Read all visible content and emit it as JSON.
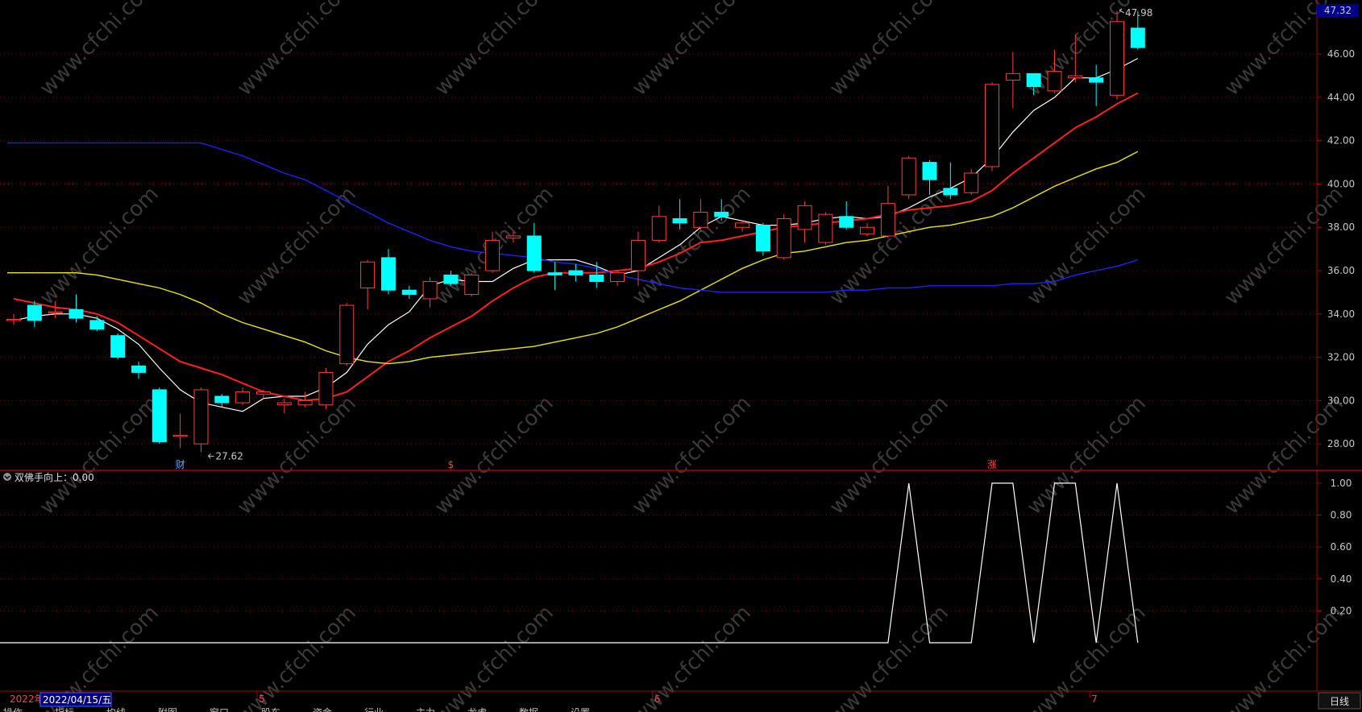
{
  "price_panel": {
    "current_price": "47.32",
    "high_label": "47.98",
    "low_label": "27.62",
    "event_markers": [
      {
        "text": "财",
        "color": "#5fa8ff",
        "idx": 8
      },
      {
        "text": "$",
        "color": "#ff4040",
        "idx": 21
      },
      {
        "text": "涨",
        "color": "#ff4040",
        "idx": 47
      }
    ]
  },
  "indicator_panel": {
    "label": "双佛手向上：0.00"
  },
  "time_axis": {
    "start_label": "2022年",
    "cursor_date": "2022/04/15/五",
    "month_labels": [
      {
        "text": "5",
        "idx": 12
      },
      {
        "text": "6",
        "idx": 31
      },
      {
        "text": "7",
        "idx": 52
      }
    ],
    "period_button": "日线"
  },
  "bottom_bar": {
    "items": [
      "操作",
      "指标",
      "均线",
      "附图",
      "窗口",
      "股东",
      "资金",
      "行业",
      "主力",
      "龙虎",
      "数据",
      "设置"
    ]
  },
  "colors": {
    "up": "#ff3c3c",
    "down": "#00ffff",
    "ma5": "#ffffff",
    "ma10": "#ff2020",
    "ma20": "#e8e800",
    "ma60": "#2020ff",
    "grid": "#8b0000",
    "panel_border": "#b00000",
    "indicator_line": "#ffffff"
  },
  "chart_data": [
    {
      "type": "candlestick",
      "title": "",
      "ylim": [
        27.0,
        48.2
      ],
      "ytick_labels": [
        "28.00",
        "30.00",
        "32.00",
        "34.00",
        "36.00",
        "38.00",
        "40.00",
        "42.00",
        "44.00",
        "46.00"
      ],
      "ohlc": [
        [
          33.75,
          33.75,
          33.5,
          34.0
        ],
        [
          34.4,
          33.7,
          33.4,
          34.6
        ],
        [
          34.1,
          34.1,
          33.8,
          34.6
        ],
        [
          34.2,
          33.8,
          33.6,
          34.9
        ],
        [
          33.7,
          33.3,
          33.2,
          33.9
        ],
        [
          33.0,
          32.0,
          31.9,
          33.1
        ],
        [
          31.6,
          31.3,
          31.0,
          31.8
        ],
        [
          30.5,
          28.1,
          28.0,
          30.6
        ],
        [
          28.4,
          28.4,
          27.8,
          29.4
        ],
        [
          28.0,
          30.5,
          27.62,
          30.6
        ],
        [
          30.2,
          29.9,
          29.7,
          30.3
        ],
        [
          29.9,
          30.4,
          29.8,
          30.6
        ],
        [
          30.3,
          30.4,
          30.1,
          30.5
        ],
        [
          29.8,
          29.9,
          29.4,
          30.1
        ],
        [
          29.8,
          30.0,
          29.7,
          30.4
        ],
        [
          29.8,
          31.3,
          29.6,
          31.5
        ],
        [
          31.7,
          34.4,
          31.6,
          34.5
        ],
        [
          35.2,
          36.4,
          34.2,
          36.5
        ],
        [
          36.6,
          35.1,
          34.9,
          37.0
        ],
        [
          35.1,
          34.9,
          34.7,
          35.3
        ],
        [
          34.7,
          35.5,
          34.3,
          35.7
        ],
        [
          35.8,
          35.4,
          35.3,
          36.0
        ],
        [
          34.9,
          35.8,
          34.8,
          35.9
        ],
        [
          36.0,
          37.4,
          35.9,
          37.8
        ],
        [
          37.5,
          37.6,
          37.3,
          37.8
        ],
        [
          37.6,
          36.0,
          35.9,
          38.2
        ],
        [
          35.9,
          35.8,
          35.1,
          36.4
        ],
        [
          36.0,
          35.8,
          35.5,
          36.3
        ],
        [
          35.8,
          35.5,
          35.2,
          36.4
        ],
        [
          35.5,
          35.9,
          35.3,
          36.0
        ],
        [
          36.0,
          37.4,
          35.3,
          37.8
        ],
        [
          37.4,
          38.5,
          37.3,
          39.0
        ],
        [
          38.4,
          38.2,
          37.9,
          39.3
        ],
        [
          38.0,
          38.7,
          37.8,
          39.3
        ],
        [
          38.7,
          38.5,
          38.3,
          39.3
        ],
        [
          38.0,
          38.2,
          37.8,
          38.3
        ],
        [
          38.1,
          36.9,
          36.7,
          38.2
        ],
        [
          36.6,
          38.4,
          36.5,
          38.6
        ],
        [
          37.9,
          39.0,
          37.3,
          39.2
        ],
        [
          37.3,
          38.6,
          37.2,
          38.7
        ],
        [
          38.5,
          38.0,
          37.9,
          39.2
        ],
        [
          37.7,
          38.0,
          37.6,
          38.2
        ],
        [
          37.6,
          39.1,
          37.5,
          39.9
        ],
        [
          39.5,
          41.2,
          39.3,
          41.3
        ],
        [
          41.0,
          40.2,
          39.5,
          41.1
        ],
        [
          39.8,
          39.5,
          39.3,
          41.0
        ],
        [
          39.6,
          40.5,
          39.5,
          40.7
        ],
        [
          40.8,
          44.6,
          40.6,
          44.7
        ],
        [
          44.8,
          45.1,
          43.5,
          46.1
        ],
        [
          45.1,
          44.5,
          44.1,
          45.1
        ],
        [
          44.3,
          45.2,
          44.2,
          46.2
        ],
        [
          44.9,
          45.0,
          44.7,
          46.9
        ],
        [
          44.9,
          44.7,
          43.6,
          45.5
        ],
        [
          44.1,
          47.5,
          43.9,
          47.98
        ],
        [
          47.2,
          46.3,
          46.2,
          47.98
        ]
      ],
      "series": [
        {
          "name": "MA5",
          "values": [
            33.7,
            33.9,
            34.0,
            34.0,
            33.8,
            33.3,
            32.6,
            31.5,
            30.5,
            29.9,
            29.7,
            29.5,
            30.1,
            30.2,
            30.2,
            30.6,
            31.3,
            32.6,
            33.5,
            34.1,
            35.3,
            35.6,
            35.5,
            35.5,
            36.1,
            36.5,
            36.5,
            36.5,
            36.2,
            35.8,
            36.0,
            36.6,
            37.2,
            38.0,
            38.5,
            38.3,
            38.1,
            38.1,
            38.2,
            38.4,
            38.5,
            38.4,
            38.5,
            38.9,
            39.4,
            39.8,
            40.3,
            41.2,
            42.4,
            43.4,
            44.0,
            44.9,
            44.9,
            45.3,
            45.8
          ]
        },
        {
          "name": "MA10",
          "values": [
            34.7,
            34.5,
            34.3,
            34.2,
            34.0,
            33.6,
            33.0,
            32.4,
            31.8,
            31.5,
            31.2,
            30.8,
            30.4,
            30.2,
            30.0,
            30.1,
            30.4,
            31.1,
            31.8,
            32.3,
            32.9,
            33.4,
            33.9,
            34.6,
            35.2,
            35.7,
            35.9,
            35.9,
            35.9,
            36.0,
            36.1,
            36.4,
            36.8,
            37.3,
            37.4,
            37.6,
            37.8,
            38.0,
            38.1,
            38.2,
            38.3,
            38.4,
            38.6,
            38.8,
            38.9,
            39.0,
            39.2,
            39.7,
            40.5,
            41.2,
            41.9,
            42.6,
            43.1,
            43.7,
            44.2
          ]
        },
        {
          "name": "MA20",
          "values": [
            35.9,
            35.8,
            35.6,
            35.4,
            35.2,
            34.9,
            34.5,
            34.0,
            33.6,
            33.3,
            33.0,
            32.7,
            32.3,
            32.0,
            31.8,
            31.7,
            31.8,
            32.0,
            32.1,
            32.2,
            32.3,
            32.4,
            32.5,
            32.7,
            32.9,
            33.1,
            33.4,
            33.8,
            34.2,
            34.6,
            35.1,
            35.6,
            36.1,
            36.5,
            36.8,
            36.9,
            37.1,
            37.3,
            37.4,
            37.6,
            37.8,
            38.0,
            38.1,
            38.3,
            38.5,
            38.9,
            39.4,
            39.9,
            40.3,
            40.7,
            41.0,
            41.5
          ]
        },
        {
          "name": "MA60",
          "values": [
            41.9,
            41.6,
            41.3,
            40.9,
            40.5,
            40.2,
            39.7,
            39.2,
            38.7,
            38.2,
            37.8,
            37.4,
            37.1,
            36.9,
            36.8,
            36.7,
            36.6,
            36.4,
            36.3,
            36.1,
            35.8,
            35.6,
            35.4,
            35.2,
            35.1,
            35.0,
            35.0,
            35.0,
            35.0,
            35.0,
            35.0,
            35.1,
            35.1,
            35.2,
            35.2,
            35.3,
            35.3,
            35.3,
            35.3,
            35.4,
            35.4,
            35.5,
            35.8,
            36.0,
            36.2,
            36.5
          ]
        }
      ]
    },
    {
      "type": "line",
      "title": "",
      "ylim": [
        0.0,
        1.05
      ],
      "ytick_labels": [
        "0.20",
        "0.40",
        "0.60",
        "0.80",
        "1.00"
      ],
      "series": [
        {
          "name": "双佛手向上",
          "values": [
            0,
            0,
            0,
            0,
            0,
            0,
            0,
            0,
            0,
            0,
            0,
            0,
            0,
            0,
            0,
            0,
            0,
            0,
            0,
            0,
            0,
            0,
            0,
            0,
            0,
            0,
            0,
            0,
            0,
            0,
            0,
            0,
            0,
            0,
            0,
            0,
            0,
            0,
            0,
            0,
            0,
            0,
            0,
            1,
            0,
            0,
            0,
            1,
            1,
            0,
            1,
            1,
            0,
            1,
            0
          ]
        }
      ]
    }
  ]
}
